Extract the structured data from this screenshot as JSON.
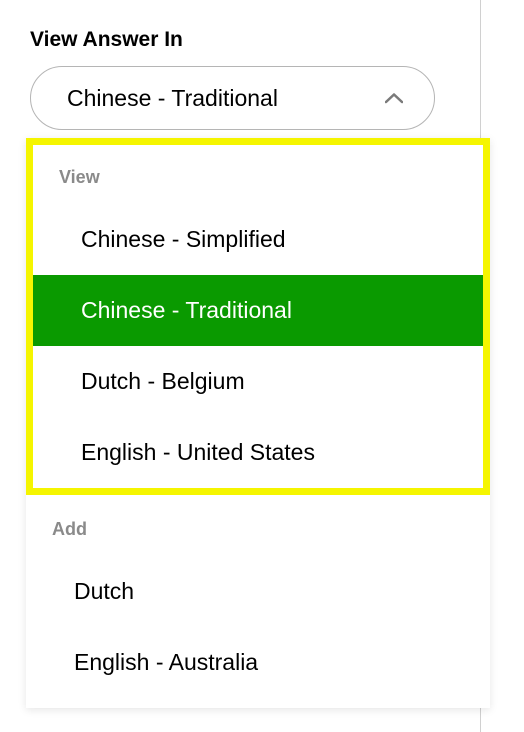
{
  "section_label": "View Answer In",
  "selected_value": "Chinese - Traditional",
  "groups": {
    "view": {
      "header": "View",
      "options": [
        {
          "label": "Chinese - Simplified",
          "selected": false
        },
        {
          "label": "Chinese - Traditional",
          "selected": true
        },
        {
          "label": "Dutch - Belgium",
          "selected": false
        },
        {
          "label": "English - United States",
          "selected": false
        }
      ]
    },
    "add": {
      "header": "Add",
      "options": [
        {
          "label": "Dutch",
          "selected": false
        },
        {
          "label": "English - Australia",
          "selected": false
        }
      ]
    }
  },
  "colors": {
    "selected_bg": "#0a9a00",
    "highlight_border": "#f5f500"
  }
}
